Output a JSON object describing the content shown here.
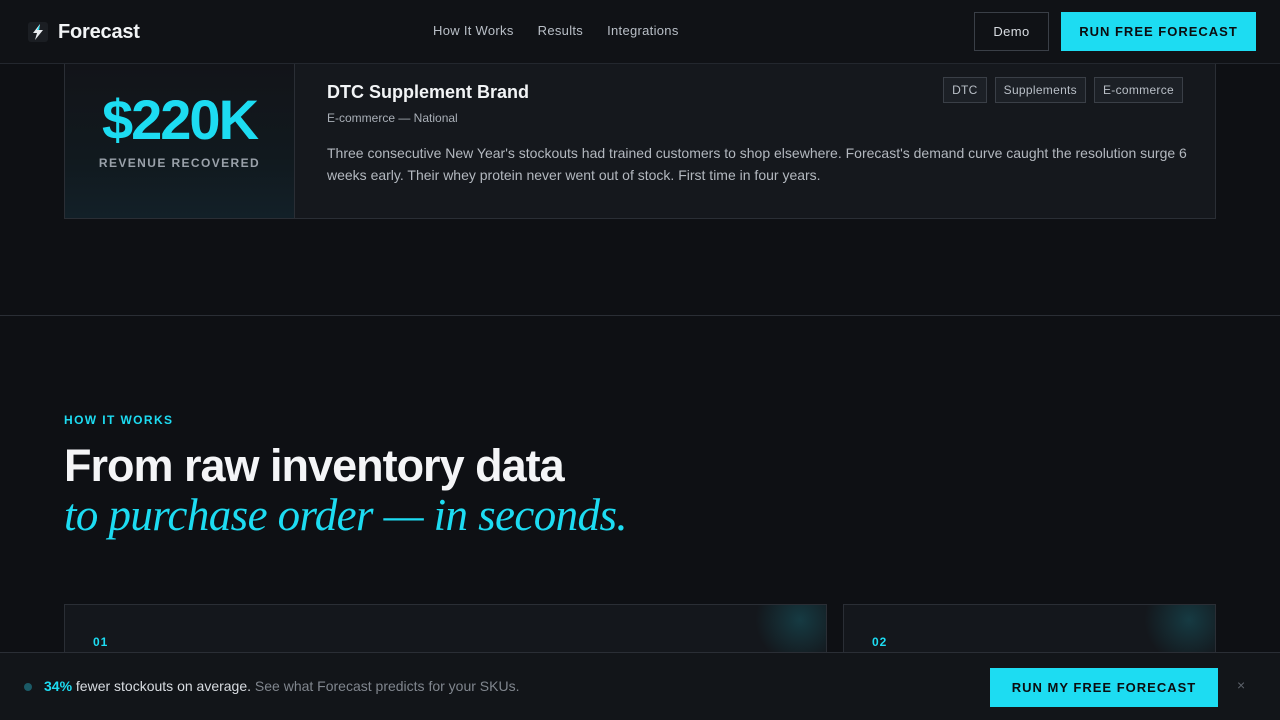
{
  "brand": {
    "name": "Forecast",
    "icon": "lightning-logo-icon"
  },
  "nav": {
    "links": [
      "How It Works",
      "Results",
      "Integrations"
    ],
    "demo_label": "Demo",
    "cta_label": "RUN FREE FORECAST"
  },
  "case": {
    "stat_value": "$220K",
    "stat_label": "REVENUE RECOVERED",
    "title": "DTC Supplement Brand",
    "subtitle": "E-commerce — National",
    "tags": [
      "DTC",
      "Supplements",
      "E-commerce"
    ],
    "description": "Three consecutive New Year's stockouts had trained customers to shop elsewhere. Forecast's demand curve caught the resolution surge 6 weeks early. Their whey protein never went out of stock. First time in four years."
  },
  "how_it_works": {
    "eyebrow": "HOW IT WORKS",
    "headline": "From raw inventory data",
    "headline_italic": "to purchase order — in seconds.",
    "steps": [
      "01",
      "02"
    ]
  },
  "sticky_bar": {
    "stat": "34%",
    "main_text": "fewer stockouts on average.",
    "sub_text": "See what Forecast predicts for your SKUs.",
    "cta_label": "RUN MY FREE FORECAST",
    "close_label": "×"
  },
  "colors": {
    "accent": "#1ddcf2",
    "background": "#0e1014",
    "card": "#15181d"
  }
}
